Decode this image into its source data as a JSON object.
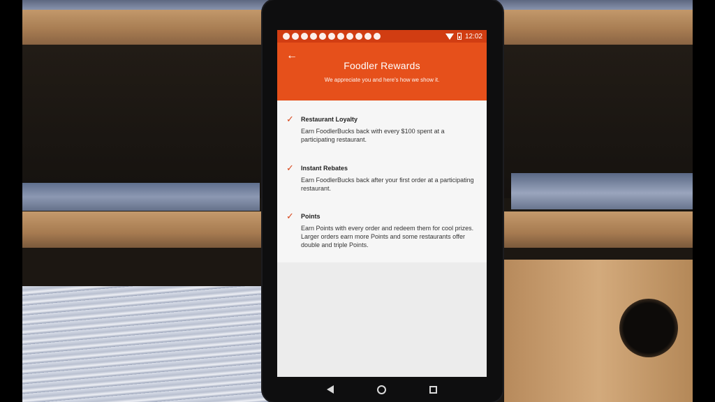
{
  "status_bar": {
    "time": "12:02"
  },
  "app_bar": {
    "title": "Foodler Rewards",
    "subtitle": "We appreciate you and here's how we show it."
  },
  "rewards": [
    {
      "title": "Restaurant Loyalty",
      "description": "Earn FoodlerBucks back with every $100 spent at a participating restaurant."
    },
    {
      "title": "Instant Rebates",
      "description": "Earn FoodlerBucks back after your first order at a participating restaurant."
    },
    {
      "title": "Points",
      "description": "Earn Points with every order and redeem them for cool prizes. Larger orders earn more Points and some restaurants offer double and triple Points."
    }
  ],
  "icons": {
    "back": "arrow-left-icon",
    "check": "checkmark-icon",
    "nav_back": "triangle-back-icon",
    "nav_home": "circle-home-icon",
    "nav_recents": "square-recents-icon"
  },
  "colors": {
    "status_bar": "#d13d12",
    "app_bar": "#e6501b",
    "accent_check": "#d8461a"
  }
}
